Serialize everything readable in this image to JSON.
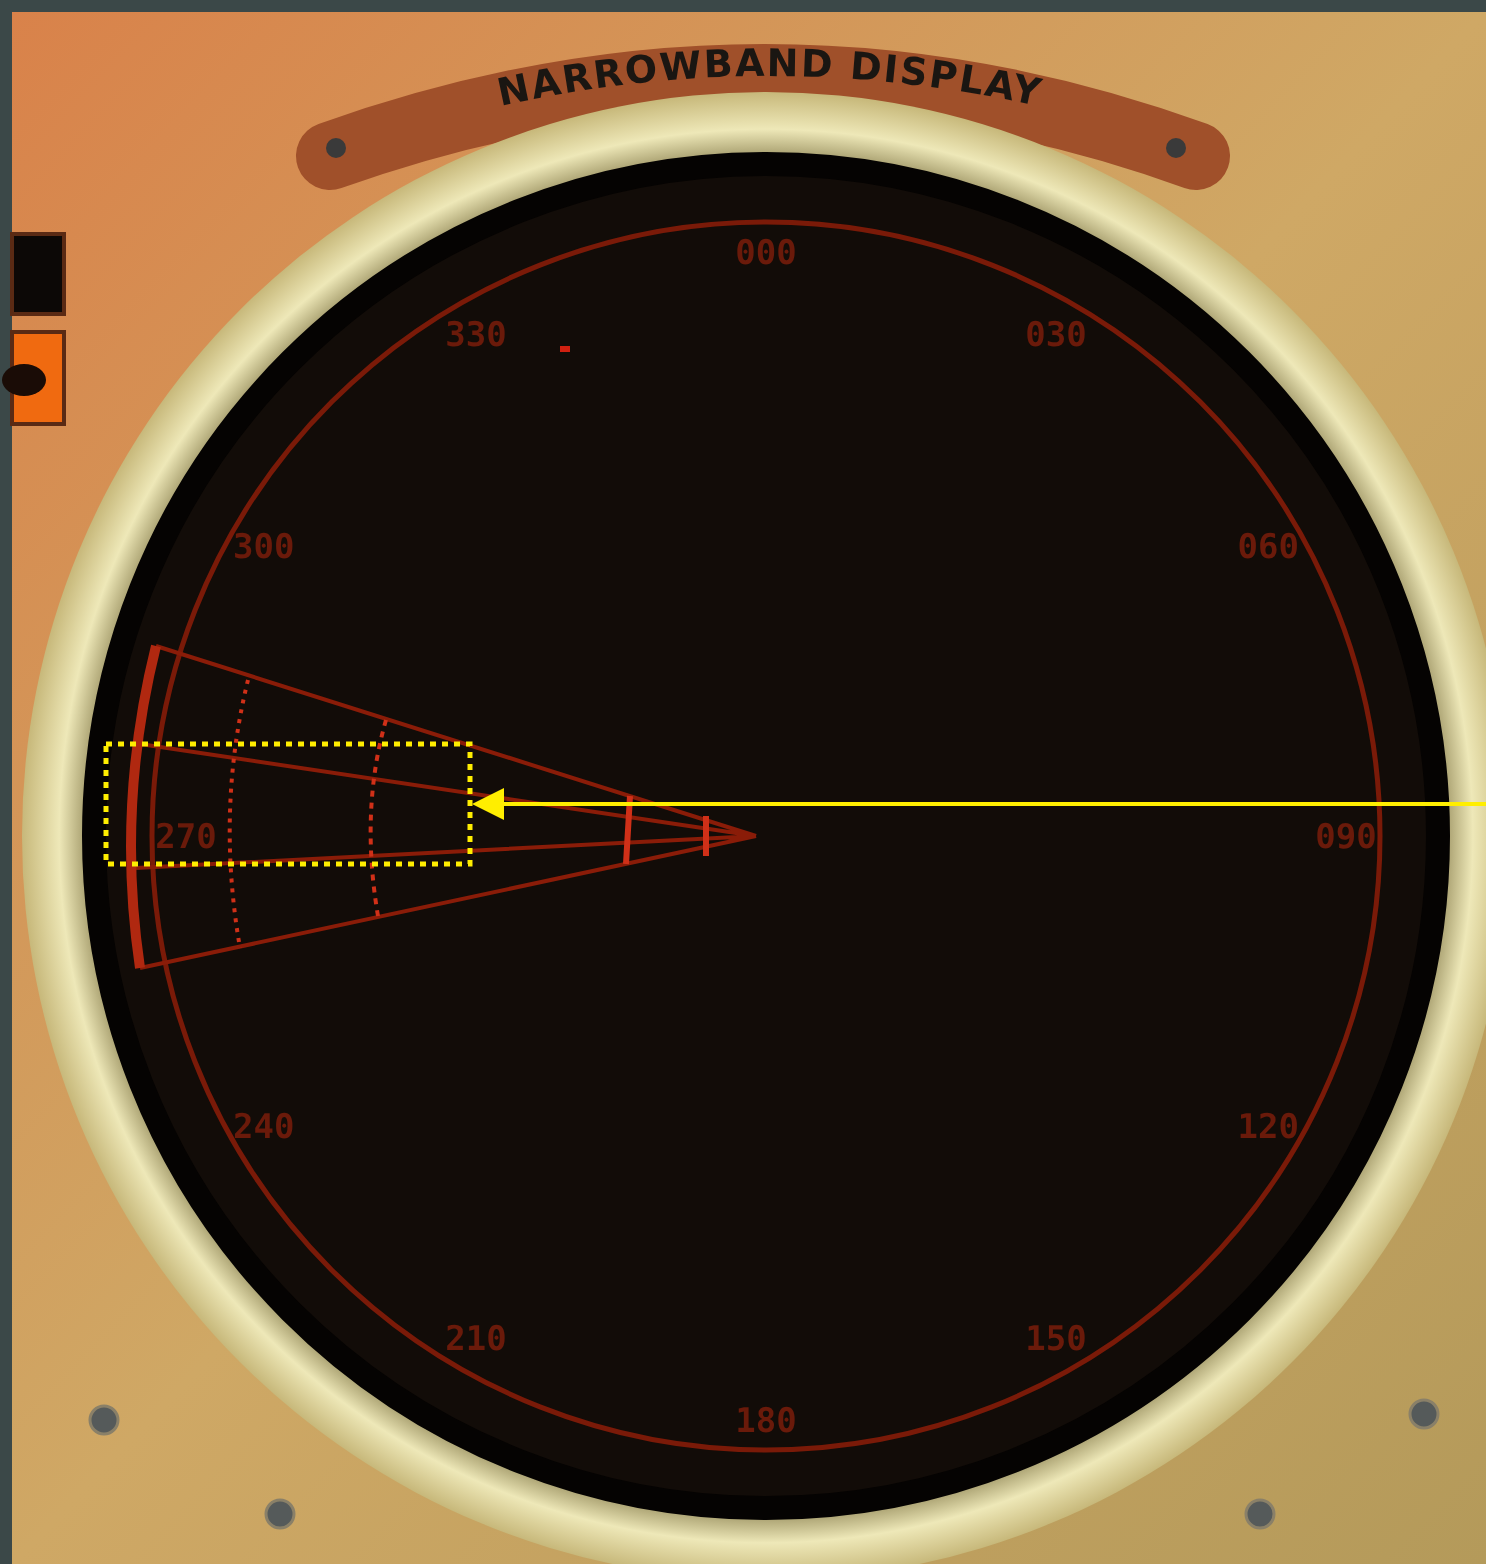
{
  "panel": {
    "title": "NARROWBAND DISPLAY"
  },
  "bearing_labels": [
    "000",
    "030",
    "060",
    "090",
    "120",
    "150",
    "180",
    "210",
    "240",
    "270",
    "300",
    "330"
  ]
}
